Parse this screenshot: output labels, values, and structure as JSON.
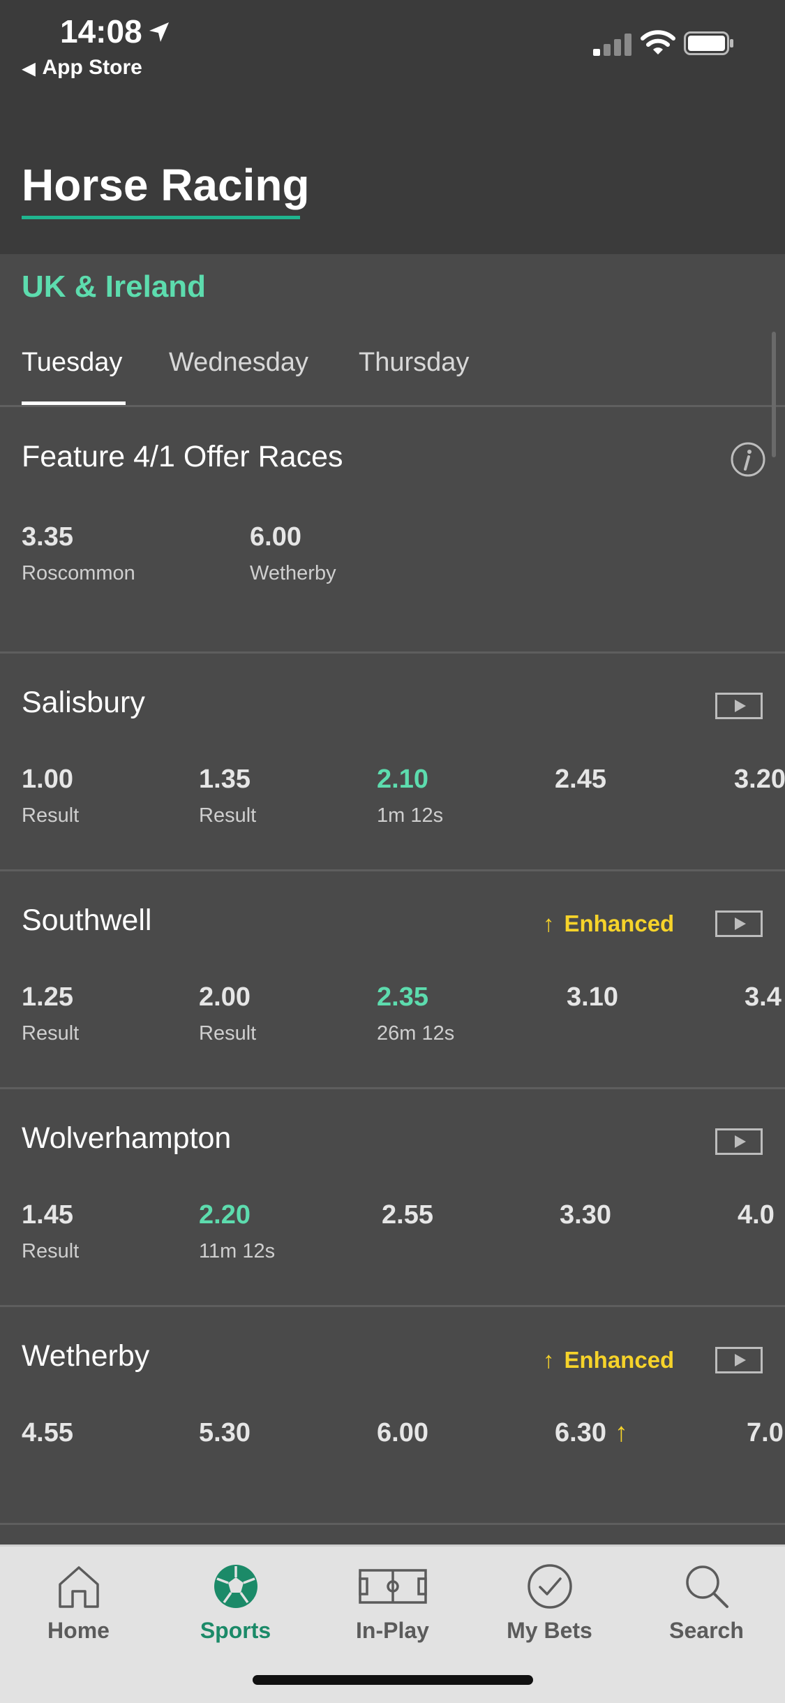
{
  "status_bar": {
    "time": "14:08",
    "back_label": "App Store"
  },
  "header": {
    "title": "Horse Racing"
  },
  "region": "UK & Ireland",
  "day_tabs": [
    {
      "label": "Tuesday",
      "active": true
    },
    {
      "label": "Wednesday",
      "active": false
    },
    {
      "label": "Thursday",
      "active": false
    }
  ],
  "feature": {
    "title": "Feature 4/1 Offer Races",
    "races": [
      {
        "time": "3.35",
        "venue": "Roscommon"
      },
      {
        "time": "6.00",
        "venue": "Wetherby"
      }
    ]
  },
  "meetings": [
    {
      "name": "Salisbury",
      "enhanced": false,
      "races": [
        {
          "time": "1.00",
          "sub": "Result"
        },
        {
          "time": "1.35",
          "sub": "Result"
        },
        {
          "time": "2.10",
          "sub": "1m 12s",
          "live": true
        },
        {
          "time": "2.45",
          "sub": ""
        },
        {
          "time": "3.20",
          "sub": ""
        }
      ]
    },
    {
      "name": "Southwell",
      "enhanced": true,
      "enhanced_label": "Enhanced",
      "races": [
        {
          "time": "1.25",
          "sub": "Result"
        },
        {
          "time": "2.00",
          "sub": "Result"
        },
        {
          "time": "2.35",
          "sub": "26m 12s",
          "live": true
        },
        {
          "time": "3.10",
          "sub": ""
        },
        {
          "time": "3.4",
          "sub": ""
        }
      ]
    },
    {
      "name": "Wolverhampton",
      "enhanced": false,
      "races": [
        {
          "time": "1.45",
          "sub": "Result"
        },
        {
          "time": "2.20",
          "sub": "11m 12s",
          "live": true
        },
        {
          "time": "2.55",
          "sub": ""
        },
        {
          "time": "3.30",
          "sub": ""
        },
        {
          "time": "4.0",
          "sub": ""
        }
      ]
    },
    {
      "name": "Wetherby",
      "enhanced": true,
      "enhanced_label": "Enhanced",
      "races": [
        {
          "time": "4.55",
          "sub": ""
        },
        {
          "time": "5.30",
          "sub": ""
        },
        {
          "time": "6.00",
          "sub": ""
        },
        {
          "time": "6.30",
          "sub": "",
          "boosted": true
        },
        {
          "time": "7.0",
          "sub": ""
        }
      ]
    }
  ],
  "tab_bar": [
    {
      "label": "Home",
      "icon": "home-icon",
      "active": false
    },
    {
      "label": "Sports",
      "icon": "football-icon",
      "active": true
    },
    {
      "label": "In-Play",
      "icon": "pitch-icon",
      "active": false
    },
    {
      "label": "My Bets",
      "icon": "check-circle-icon",
      "active": false
    },
    {
      "label": "Search",
      "icon": "search-icon",
      "active": false
    }
  ],
  "colors": {
    "accent": "#5ddcae",
    "active_tab": "#1b8a68",
    "enhanced": "#f6d32a",
    "header_bg": "#3b3b3b",
    "content_bg": "#4a4a4a"
  }
}
